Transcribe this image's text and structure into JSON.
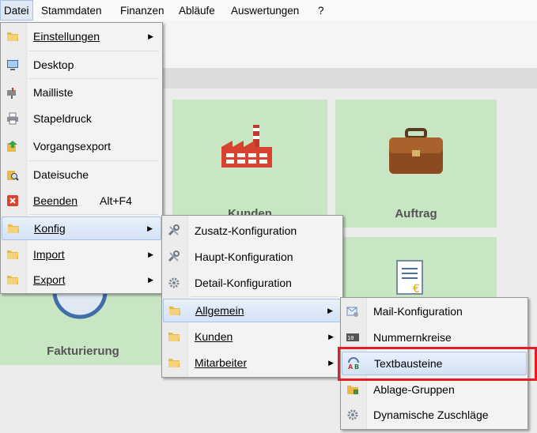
{
  "menubar": {
    "items": [
      "Datei",
      "Stammdaten",
      "Finanzen",
      "Abläufe",
      "Auswertungen",
      "?"
    ]
  },
  "tiles": {
    "kunden": "Kunden",
    "auftrag": "Auftrag",
    "fakturierung": "Fakturierung"
  },
  "datei_menu": {
    "items": [
      {
        "label": "Einstellungen",
        "icon": "folder-icon",
        "submenu": true
      },
      {
        "label": "Desktop",
        "icon": "desktop-icon"
      },
      {
        "label": "Mailliste",
        "icon": "mailbox-icon"
      },
      {
        "label": "Stapeldruck",
        "icon": "printer-icon"
      },
      {
        "label": "Vorgangsexport",
        "icon": "export-icon"
      },
      {
        "label": "Dateisuche",
        "icon": "file-search-icon"
      },
      {
        "label": "Beenden",
        "shortcut": "Alt+F4",
        "icon": "close-icon"
      },
      {
        "label": "Konfig",
        "icon": "folder-icon",
        "submenu": true
      },
      {
        "label": "Import",
        "icon": "folder-icon",
        "submenu": true
      },
      {
        "label": "Export",
        "icon": "folder-icon",
        "submenu": true
      }
    ]
  },
  "konfig_menu": {
    "items": [
      {
        "label": "Zusatz-Konfiguration",
        "icon": "tools-icon"
      },
      {
        "label": "Haupt-Konfiguration",
        "icon": "tools-icon"
      },
      {
        "label": "Detail-Konfiguration",
        "icon": "gear-icon"
      },
      {
        "label": "Allgemein",
        "icon": "folder-icon",
        "submenu": true
      },
      {
        "label": "Kunden",
        "icon": "folder-icon",
        "submenu": true
      },
      {
        "label": "Mitarbeiter",
        "icon": "folder-icon",
        "submenu": true
      }
    ]
  },
  "allgemein_menu": {
    "items": [
      {
        "label": "Mail-Konfiguration",
        "icon": "mail-config-icon"
      },
      {
        "label": "Nummernkreise",
        "icon": "number-range-icon"
      },
      {
        "label": "Textbausteine",
        "icon": "text-blocks-icon"
      },
      {
        "label": "Ablage-Gruppen",
        "icon": "folder-group-icon"
      },
      {
        "label": "Dynamische Zuschläge",
        "icon": "gear-icon"
      }
    ]
  },
  "colors": {
    "highlight": "#e31e24",
    "tile": "#c8e6c4",
    "menu_active": "#d3e2f5"
  }
}
